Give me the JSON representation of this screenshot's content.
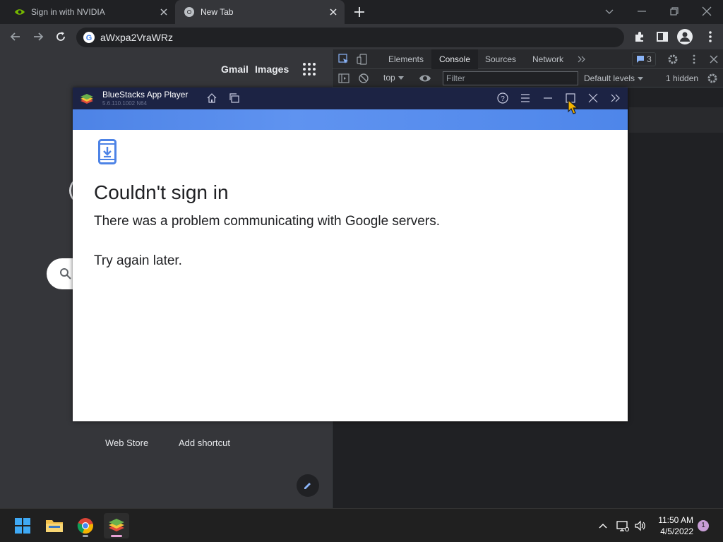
{
  "browser": {
    "tabs": [
      {
        "title": "Sign in with NVIDIA",
        "active": false
      },
      {
        "title": "New Tab",
        "active": true
      }
    ],
    "address": "aWxpa2VraWRz",
    "new_tab_page": {
      "links": [
        "Gmail",
        "Images"
      ],
      "shortcuts": [
        "Web Store",
        "Add shortcut"
      ]
    }
  },
  "devtools": {
    "tabs": [
      "Elements",
      "Console",
      "Sources",
      "Network"
    ],
    "active_tab": "Console",
    "message_count": "3",
    "context": "top",
    "filter_placeholder": "Filter",
    "levels": "Default levels",
    "hidden": "1 hidden"
  },
  "bluestacks": {
    "title": "BlueStacks App Player",
    "version": "5.6.110.1002 N64",
    "error_title": "Couldn't sign in",
    "error_message": "There was a problem communicating with Google servers.",
    "error_retry": "Try again later."
  },
  "taskbar": {
    "time": "11:50 AM",
    "date": "4/5/2022",
    "notification_count": "1"
  },
  "colors": {
    "accent_blue": "#4d83e6",
    "titlebar": "#1c2344",
    "chrome_dark": "#202124"
  }
}
